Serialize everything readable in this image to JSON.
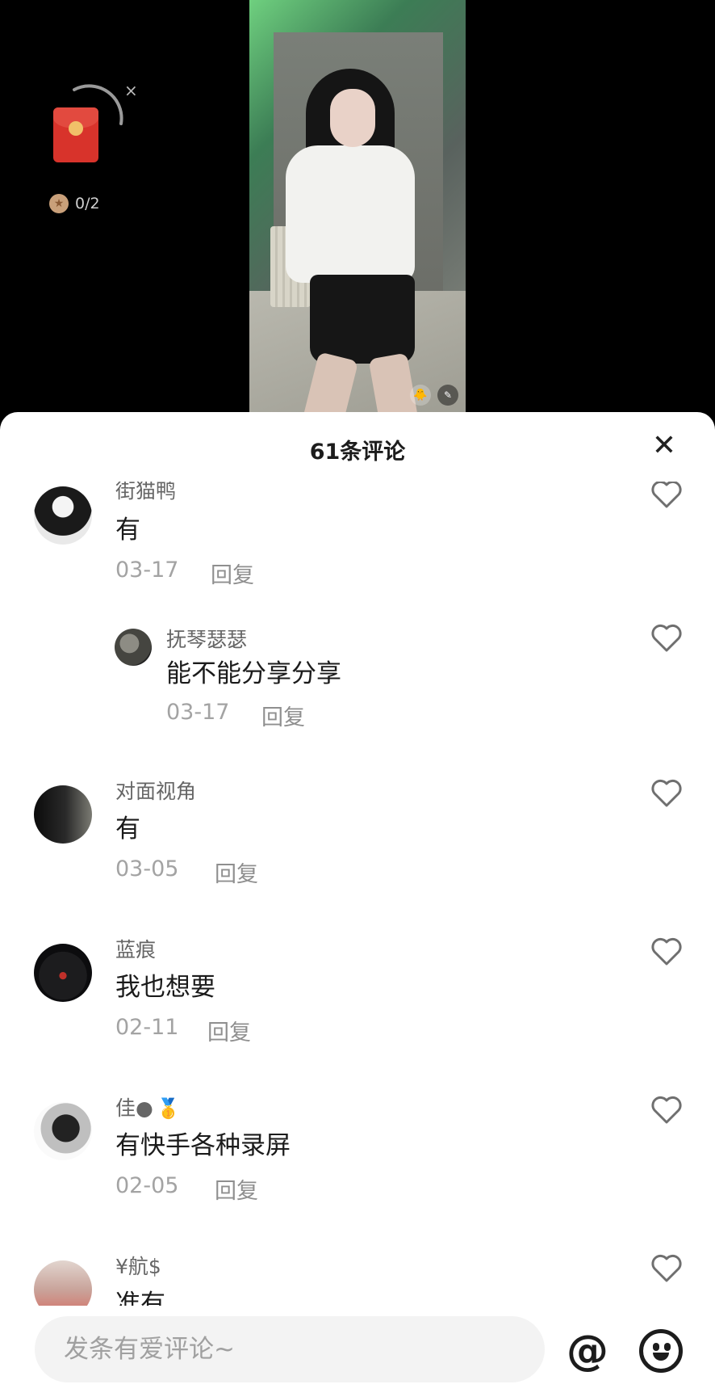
{
  "reward_widget": {
    "progress_text": "0/2",
    "close_glyph": "×",
    "progress_fraction": 0
  },
  "panel": {
    "title": "61条评论",
    "close_glyph": "✕"
  },
  "comments": [
    {
      "user": "街猫鸭",
      "text": "有",
      "date": "03-17",
      "reply_label": "回复",
      "liked": false
    },
    {
      "user": "抚琴瑟瑟",
      "text": "能不能分享分享",
      "date": "03-17",
      "reply_label": "回复",
      "liked": false,
      "is_reply": true
    },
    {
      "user": "对面视角",
      "text": "有",
      "date": "03-05",
      "reply_label": "回复",
      "liked": false
    },
    {
      "user": "蓝痕",
      "text": "我也想要",
      "date": "02-11",
      "reply_label": "回复",
      "liked": false
    },
    {
      "user": "佳●",
      "badge": "🥇",
      "text": "有快手各种录屏",
      "date": "02-05",
      "reply_label": "回复",
      "liked": false
    },
    {
      "user": "¥航$",
      "text": "准有",
      "liked": false
    }
  ],
  "input": {
    "placeholder": "发条有爱评论~",
    "value": ""
  },
  "actions": {
    "at_glyph": "@"
  },
  "icons": [
    "duck-icon",
    "note-icon",
    "red-envelope-icon",
    "coin-icon",
    "close-icon",
    "heart-icon",
    "at-icon",
    "emoji-icon"
  ]
}
